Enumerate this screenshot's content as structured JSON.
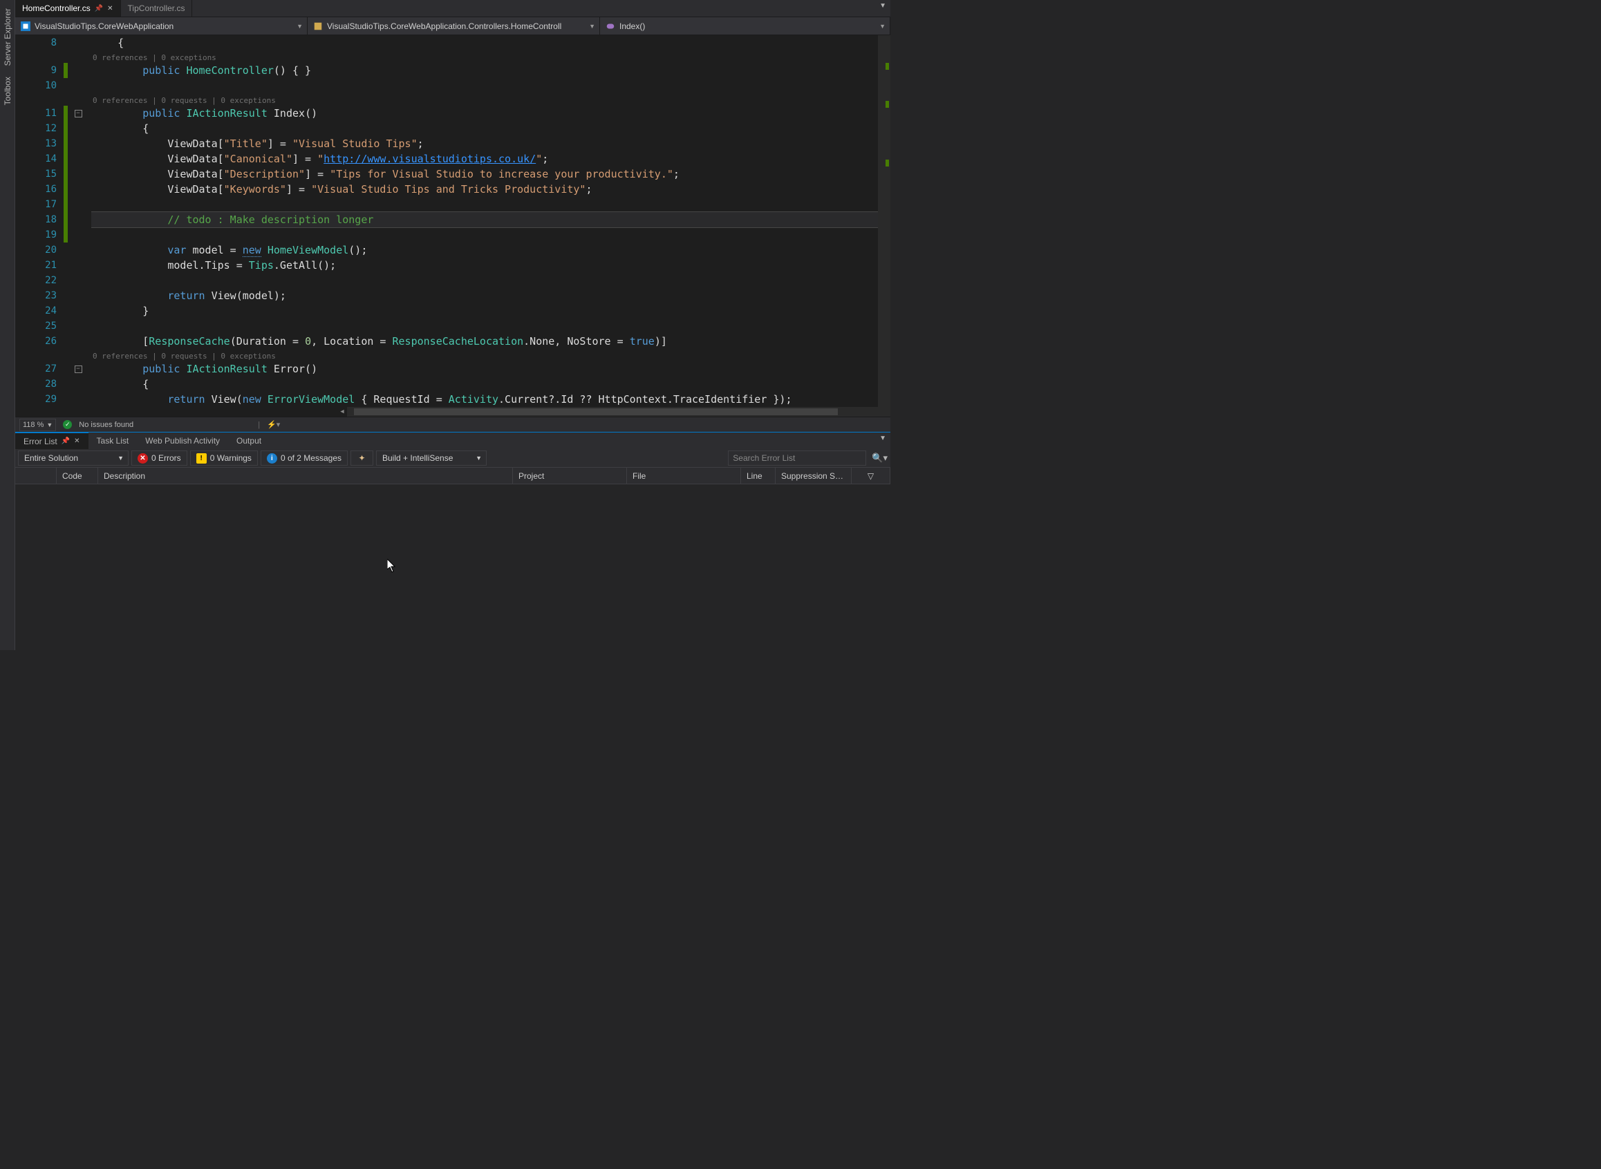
{
  "sideTabs": [
    "Server Explorer",
    "Toolbox"
  ],
  "fileTabs": [
    {
      "name": "HomeController.cs",
      "active": true
    },
    {
      "name": "TipController.cs",
      "active": false
    }
  ],
  "navBar": {
    "scope": "VisualStudioTips.CoreWebApplication",
    "type": "VisualStudioTips.CoreWebApplication.Controllers.HomeControll",
    "member": "Index()"
  },
  "codelens": {
    "ctor": "0 references | 0 exceptions",
    "index": "0 references | 0 requests | 0 exceptions",
    "error": "0 references | 0 requests | 0 exceptions"
  },
  "code": {
    "l8_brace": "{",
    "l9_kw": "public",
    "l9_ctor": "HomeController",
    "l9_tail": "() { }",
    "l11_kw": "public",
    "l11_type": "IActionResult",
    "l11_m": "Index",
    "l11_tail": "()",
    "l12_brace": "{",
    "l13_a": "ViewData[",
    "l13_k": "\"Title\"",
    "l13_b": "] = ",
    "l13_v": "\"Visual Studio Tips\"",
    "l13_c": ";",
    "l14_a": "ViewData[",
    "l14_k": "\"Canonical\"",
    "l14_b": "] = ",
    "l14_q1": "\"",
    "l14_url": "http://www.visualstudiotips.co.uk/",
    "l14_q2": "\"",
    "l14_c": ";",
    "l15_a": "ViewData[",
    "l15_k": "\"Description\"",
    "l15_b": "] = ",
    "l15_v": "\"Tips for Visual Studio to increase your productivity.\"",
    "l15_c": ";",
    "l16_a": "ViewData[",
    "l16_k": "\"Keywords\"",
    "l16_b": "] = ",
    "l16_v": "\"Visual Studio Tips and Tricks Productivity\"",
    "l16_c": ";",
    "l18_cmt": "// todo : Make description longer",
    "l20_var": "var",
    "l20_a": " model = ",
    "l20_new": "new",
    "l20_type": " HomeViewModel",
    "l20_tail": "();",
    "l21_a": "model.Tips = ",
    "l21_type": "Tips",
    "l21_b": ".GetAll();",
    "l23_ret": "return",
    "l23_a": " View(model);",
    "l24_brace": "}",
    "l26_a": "[",
    "l26_type": "ResponseCache",
    "l26_b": "(Duration = ",
    "l26_n0": "0",
    "l26_c": ", Location = ",
    "l26_enum": "ResponseCacheLocation",
    "l26_d": ".None, NoStore = ",
    "l26_true": "true",
    "l26_e": ")]",
    "l27_kw": "public",
    "l27_type": "IActionResult",
    "l27_m": " Error()",
    "l28_brace": "{",
    "l29_ret": "return",
    "l29_a": " View(",
    "l29_new": "new",
    "l29_type": " ErrorViewModel",
    "l29_b": " { RequestId = ",
    "l29_act": "Activity",
    "l29_c": ".Current?.Id ?? HttpContext.TraceIdentifier });"
  },
  "lineNumbers": [
    "8",
    "9",
    "10",
    "11",
    "12",
    "13",
    "14",
    "15",
    "16",
    "17",
    "18",
    "19",
    "20",
    "21",
    "22",
    "23",
    "24",
    "25",
    "26",
    "27",
    "28",
    "29"
  ],
  "statusBar": {
    "zoom": "118 %",
    "issues": "No issues found"
  },
  "panel": {
    "tabs": [
      "Error List",
      "Task List",
      "Web Publish Activity",
      "Output"
    ],
    "scope": "Entire Solution",
    "errors": "0 Errors",
    "warnings": "0 Warnings",
    "messages": "0 of 2 Messages",
    "buildMode": "Build + IntelliSense",
    "searchPlaceholder": "Search Error List",
    "columns": [
      "",
      "Code",
      "Description",
      "Project",
      "File",
      "Line",
      "Suppression S…"
    ]
  }
}
